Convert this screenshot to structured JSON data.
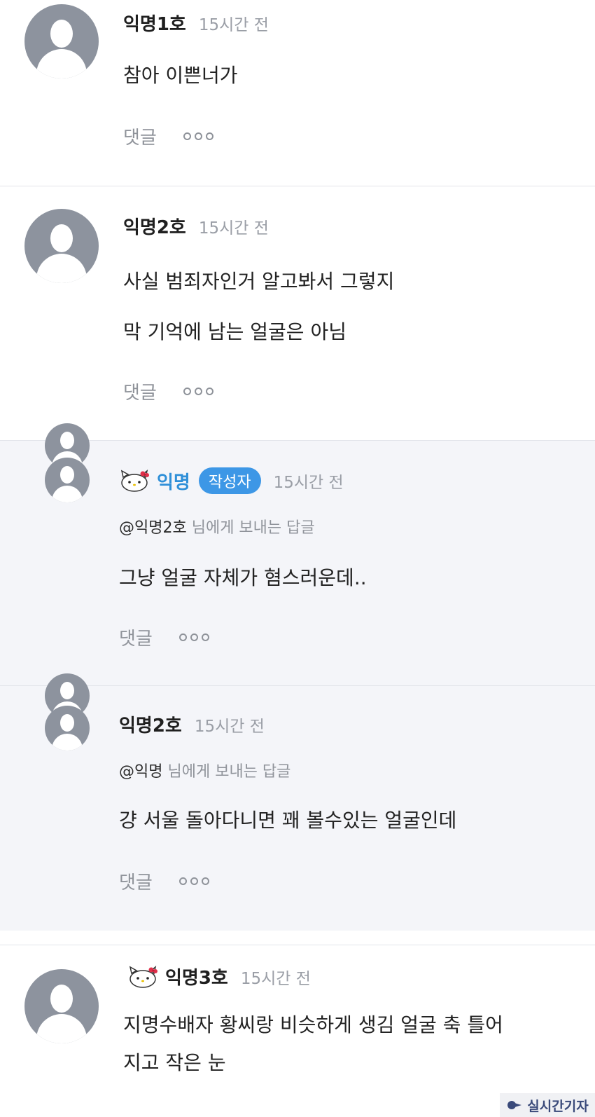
{
  "comments": [
    {
      "author": "익명1호",
      "time": "15시간 전",
      "lines": [
        "참아 이쁜너가"
      ],
      "reply_label": "댓글"
    },
    {
      "author": "익명2호",
      "time": "15시간 전",
      "lines": [
        "사실 범죄자인거 알고봐서 그렇지",
        "막 기억에 남는 얼굴은 아님"
      ],
      "reply_label": "댓글"
    },
    {
      "author": "익명",
      "badge": "작성자",
      "time": "15시간 전",
      "mention_user": "@익명2호",
      "mention_suffix": "님에게 보내는 답글",
      "lines": [
        "그냥 얼굴 자체가 혐스러운데.."
      ],
      "reply_label": "댓글"
    },
    {
      "author": "익명2호",
      "time": "15시간 전",
      "mention_user": "@익명",
      "mention_suffix": "님에게 보내는 답글",
      "lines": [
        "걍 서울 돌아다니면 꽤 볼수있는 얼굴인데"
      ],
      "reply_label": "댓글"
    },
    {
      "author": "익명3호",
      "time": "15시간 전",
      "lines": [
        "지명수배자 황씨랑 비슷하게 생김 얼굴 축 틀어",
        "지고 작은 눈"
      ]
    }
  ],
  "watermark": "실시간기자",
  "colors": {
    "author_blue": "#2e8fd8",
    "badge_bg": "#3d97e6",
    "reply_bg": "#f4f5f9"
  }
}
